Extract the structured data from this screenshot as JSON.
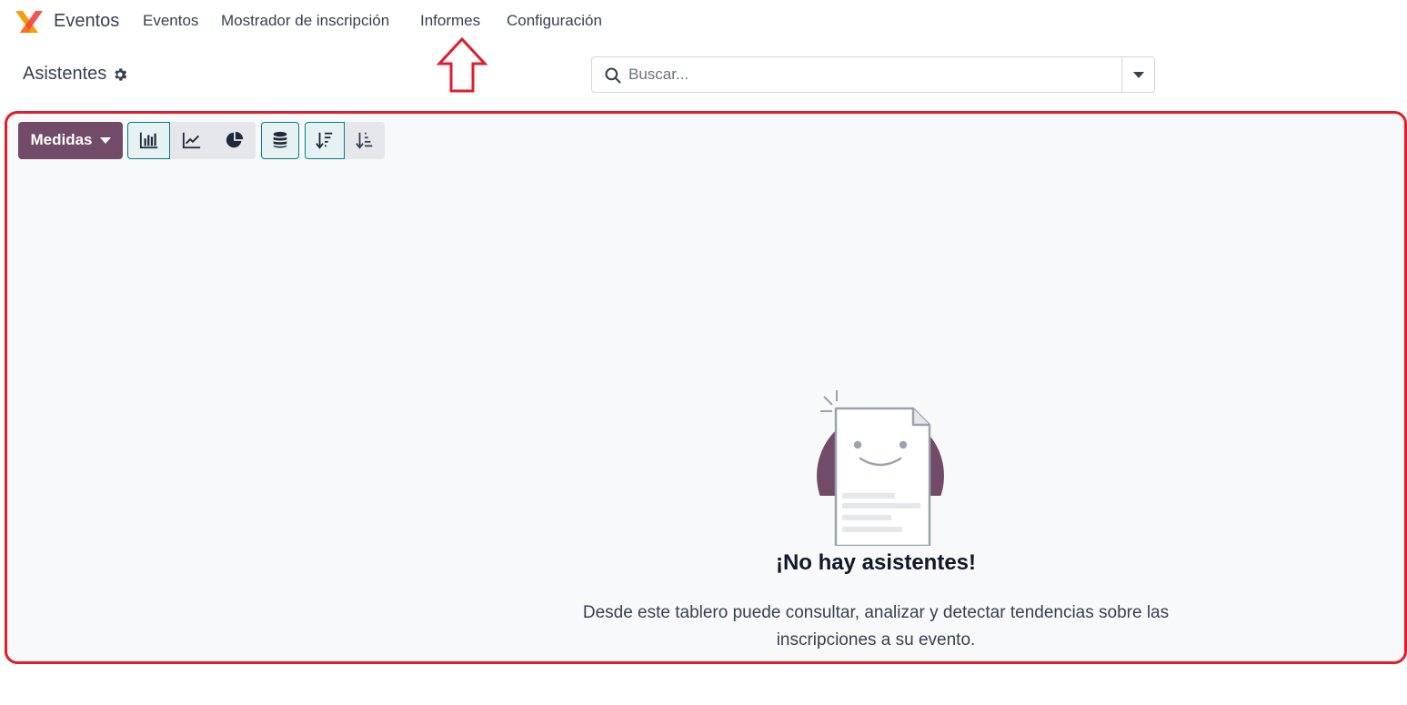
{
  "nav": {
    "app_name": "Eventos",
    "items": [
      "Eventos",
      "Mostrador de inscripción",
      "Informes",
      "Configuración"
    ]
  },
  "breadcrumb": {
    "title": "Asistentes"
  },
  "search": {
    "placeholder": "Buscar..."
  },
  "toolbar": {
    "measures_label": "Medidas",
    "chart_types": [
      {
        "icon": "bar-chart-icon",
        "active": true
      },
      {
        "icon": "line-chart-icon",
        "active": false
      },
      {
        "icon": "pie-chart-icon",
        "active": false
      }
    ],
    "stacked": {
      "icon": "database-stack-icon",
      "active": true
    },
    "order": [
      {
        "icon": "sort-descending-icon",
        "active": true
      },
      {
        "icon": "sort-ascending-icon",
        "active": false
      }
    ]
  },
  "empty_state": {
    "title": "¡No hay asistentes!",
    "description": "Desde este tablero puede consultar, analizar y detectar tendencias sobre las inscripciones a su evento."
  },
  "colors": {
    "brand": "#714b67",
    "accent": "#017e84",
    "annotation": "#e11d2a"
  }
}
